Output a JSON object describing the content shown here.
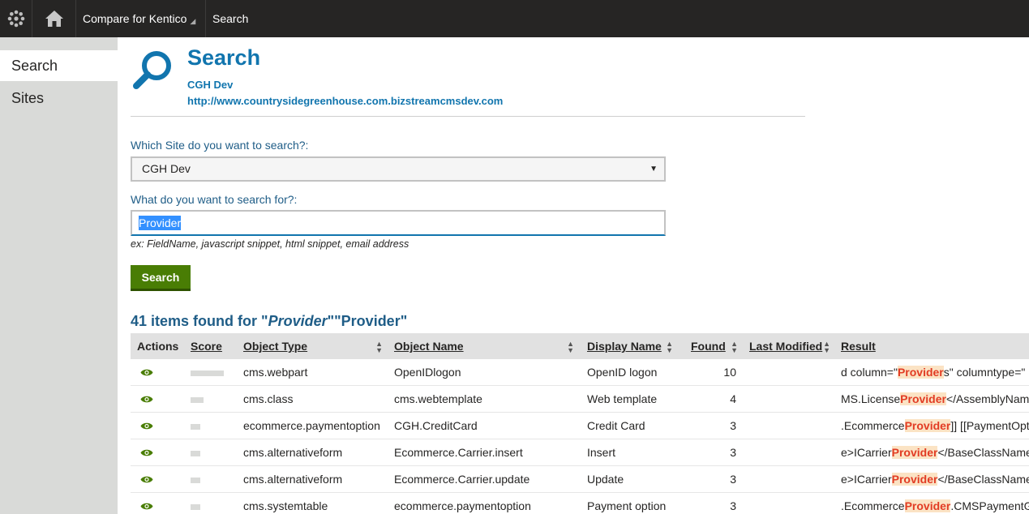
{
  "topbar": {
    "app_name": "Compare for Kentico",
    "breadcrumb": "Search"
  },
  "leftnav": {
    "items": [
      {
        "label": "Search",
        "active": true
      },
      {
        "label": "Sites",
        "active": false
      }
    ]
  },
  "header": {
    "title": "Search",
    "site_name": "CGH Dev",
    "site_url": "http://www.countrysidegreenhouse.com.bizstreamcmsdev.com"
  },
  "form": {
    "site_label": "Which Site do you want to search?:",
    "site_value": "CGH Dev",
    "query_label": "What do you want to search for?:",
    "query_value": "Provider",
    "hint": "ex: FieldName, javascript snippet, html snippet, email address",
    "search_button": "Search"
  },
  "results": {
    "count_text": "41 items found for \"",
    "term_italic": "Provider",
    "mid_text": "\"\"",
    "term_plain": "Provider",
    "end_text": "\"",
    "columns": [
      "Actions",
      "Score",
      "Object Type",
      "Object Name",
      "Display Name",
      "Found",
      "Last Modified",
      "Result"
    ],
    "rows": [
      {
        "score": 1.0,
        "object_type": "cms.webpart",
        "object_name": "OpenIDlogon",
        "display_name": "OpenID logon",
        "found": "10",
        "last_modified": "",
        "result_pre": "d column=\"",
        "result_hl": "Provider",
        "result_post": "s\" columntype=\""
      },
      {
        "score": 0.4,
        "object_type": "cms.class",
        "object_name": "cms.webtemplate",
        "display_name": "Web template",
        "found": "4",
        "last_modified": "",
        "result_pre": "MS.License",
        "result_hl": "Provider",
        "result_post": "</AssemblyName"
      },
      {
        "score": 0.3,
        "object_type": "ecommerce.paymentoption",
        "object_name": "CGH.CreditCard",
        "display_name": "Credit Card",
        "found": "3",
        "last_modified": "",
        "result_pre": ".Ecommerce",
        "result_hl": "Provider",
        "result_post": "]] [[PaymentOpti"
      },
      {
        "score": 0.3,
        "object_type": "cms.alternativeform",
        "object_name": "Ecommerce.Carrier.insert",
        "display_name": "Insert",
        "found": "3",
        "last_modified": "",
        "result_pre": "e>ICarrier",
        "result_hl": "Provider",
        "result_post": "</BaseClassName"
      },
      {
        "score": 0.3,
        "object_type": "cms.alternativeform",
        "object_name": "Ecommerce.Carrier.update",
        "display_name": "Update",
        "found": "3",
        "last_modified": "",
        "result_pre": "e>ICarrier",
        "result_hl": "Provider",
        "result_post": "</BaseClassName"
      },
      {
        "score": 0.3,
        "object_type": "cms.systemtable",
        "object_name": "ecommerce.paymentoption",
        "display_name": "Payment option",
        "found": "3",
        "last_modified": "",
        "result_pre": ".Ecommerce",
        "result_hl": "Provider",
        "result_post": ".CMSPaymentGa"
      }
    ]
  },
  "colors": {
    "accent": "#1175ae",
    "label": "#1f5d87",
    "button": "#497d04",
    "eye": "#497d04",
    "highlight_text": "#e23c24",
    "highlight_bg": "#fbe3c4"
  }
}
